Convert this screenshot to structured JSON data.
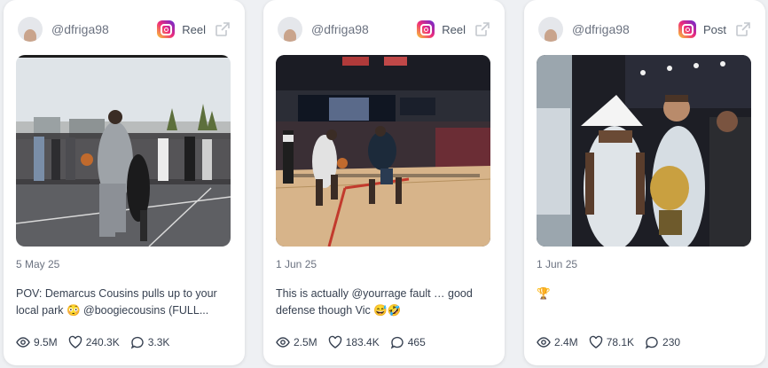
{
  "cards": [
    {
      "handle": "@dfriga98",
      "type_label": "Reel",
      "date": "5 May 25",
      "caption": "POV: Demarcus Cousins pulls up to your local park 😳 @boogiecousins (FULL...",
      "views": "9.5M",
      "likes": "240.3K",
      "comments": "3.3K"
    },
    {
      "handle": "@dfriga98",
      "type_label": "Reel",
      "date": "1 Jun 25",
      "caption": "This is actually @yourrage fault … good defense though Vic 😅🤣",
      "views": "2.5M",
      "likes": "183.4K",
      "comments": "465"
    },
    {
      "handle": "@dfriga98",
      "type_label": "Post",
      "date": "1 Jun 25",
      "caption": "🏆",
      "views": "2.4M",
      "likes": "78.1K",
      "comments": "230"
    }
  ],
  "icons": {
    "platform": "instagram-icon",
    "external": "external-link-icon",
    "views": "eye-icon",
    "likes": "heart-icon",
    "comments": "comment-icon"
  },
  "colors": {
    "card_bg": "#ffffff",
    "page_bg": "#eef0f3",
    "text_muted": "#6b7280",
    "text_body": "#374151"
  }
}
